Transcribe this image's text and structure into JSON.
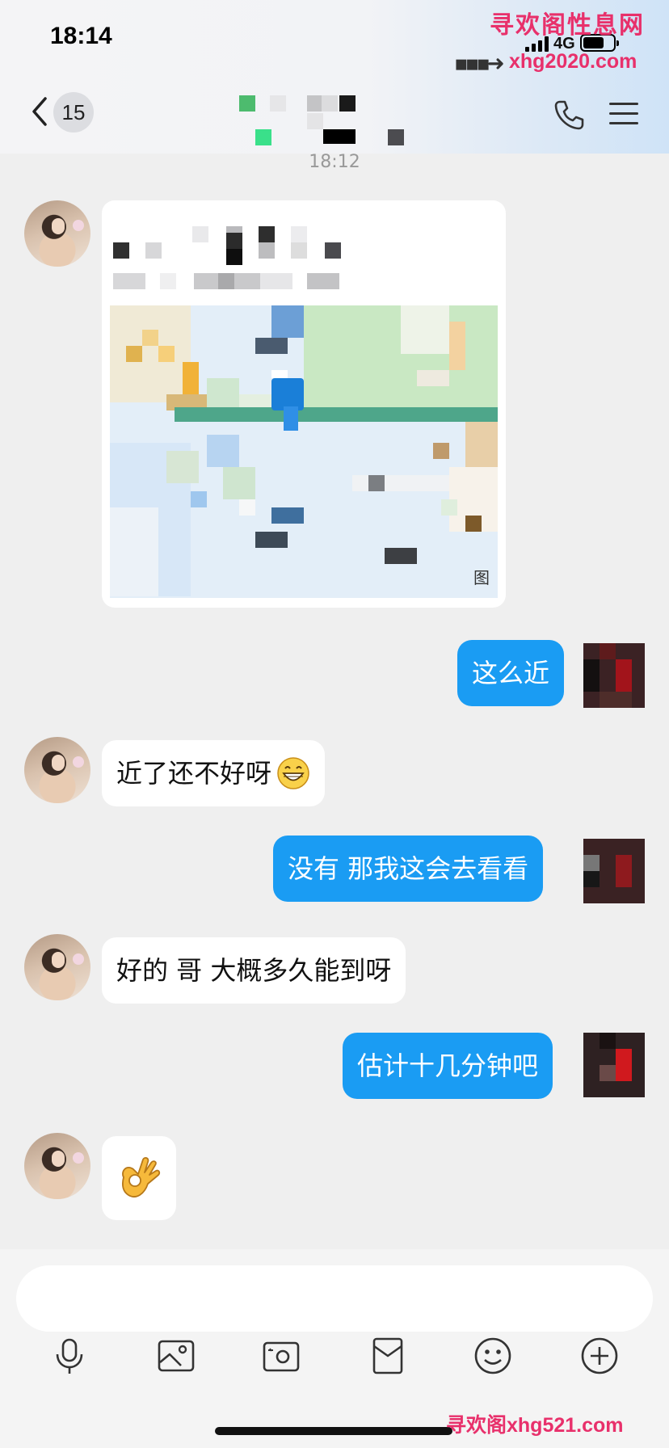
{
  "status_bar": {
    "time": "18:14",
    "network": "4G"
  },
  "watermarks": {
    "top_cn": "寻欢阁性息网",
    "top_url": "xhg2020.com",
    "bottom": "寻欢阁xhg521.com"
  },
  "header": {
    "unread_count": "15",
    "contact_name": "",
    "icons": [
      "back-chevron-icon",
      "phone-icon",
      "menu-icon"
    ]
  },
  "chat": {
    "timestamp": "18:12",
    "messages": [
      {
        "side": "left",
        "type": "location",
        "title": "",
        "address": "",
        "map_copyright": "图"
      },
      {
        "side": "right",
        "type": "text",
        "text": "这么近"
      },
      {
        "side": "left",
        "type": "text",
        "text": "近了还不好呀",
        "emoji": "grin-icon"
      },
      {
        "side": "right",
        "type": "text",
        "text": "没有  那我这会去看看"
      },
      {
        "side": "left",
        "type": "text",
        "text": "好的 哥  大概多久能到呀"
      },
      {
        "side": "right",
        "type": "text",
        "text": "估计十几分钟吧"
      },
      {
        "side": "left",
        "type": "sticker",
        "emoji": "ok-hand-icon"
      }
    ]
  },
  "input_bar": {
    "placeholder": "",
    "tools": [
      "microphone-icon",
      "image-icon",
      "camera-icon",
      "red-packet-icon",
      "emoji-icon",
      "plus-icon"
    ]
  },
  "colors": {
    "accent": "#1a9cf3",
    "background": "#efefef",
    "watermark": "#e8306b"
  }
}
